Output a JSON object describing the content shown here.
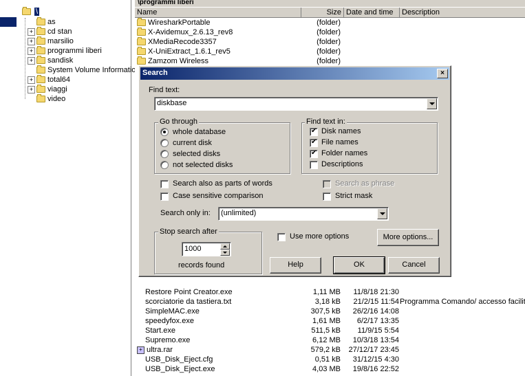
{
  "path_bar": {
    "text": "\\programmi liberi"
  },
  "tree": {
    "root_label": "\\",
    "items": [
      {
        "label": "as",
        "expandable": false
      },
      {
        "label": "cd stan",
        "expandable": true
      },
      {
        "label": "marsilio",
        "expandable": true
      },
      {
        "label": "programmi liberi",
        "expandable": true
      },
      {
        "label": "sandisk",
        "expandable": true
      },
      {
        "label": "System Volume Information",
        "expandable": false
      },
      {
        "label": "total64",
        "expandable": true
      },
      {
        "label": "viaggi",
        "expandable": true
      },
      {
        "label": "video",
        "expandable": false
      }
    ]
  },
  "list": {
    "headers": {
      "name": "Name",
      "size": "Size",
      "date": "Date and time",
      "desc": "Description"
    },
    "top_rows": [
      {
        "name": "WiresharkPortable",
        "size": "(folder)",
        "date": "",
        "desc": ""
      },
      {
        "name": "X-Avidemux_2.6.13_rev8",
        "size": "(folder)",
        "date": "",
        "desc": ""
      },
      {
        "name": "XMediaRecode3357",
        "size": "(folder)",
        "date": "",
        "desc": ""
      },
      {
        "name": "X-UniExtract_1.6.1_rev5",
        "size": "(folder)",
        "date": "",
        "desc": ""
      },
      {
        "name": "Zamzom Wireless",
        "size": "(folder)",
        "date": "",
        "desc": ""
      }
    ],
    "bottom_rows": [
      {
        "name": "Restore Point Creator.exe",
        "size": "1,11 MB",
        "date": "11/8/18 21:30",
        "desc": ""
      },
      {
        "name": "scorciatorie da tastiera.txt",
        "size": "3,18 kB",
        "date": "21/2/15 11:54",
        "desc": "Programma Comando/ accesso facilita"
      },
      {
        "name": "SimpleMAC.exe",
        "size": "307,5 kB",
        "date": "26/2/16 14:08",
        "desc": ""
      },
      {
        "name": "speedyfox.exe",
        "size": "1,61 MB",
        "date": "6/2/17 13:35",
        "desc": ""
      },
      {
        "name": "Start.exe",
        "size": "511,5 kB",
        "date": "11/9/15  5:54",
        "desc": ""
      },
      {
        "name": "Supremo.exe",
        "size": "6,12 MB",
        "date": "10/3/18 13:54",
        "desc": ""
      },
      {
        "name": "ultra.rar",
        "size": "579,2 kB",
        "date": "27/12/17 23:45",
        "desc": ""
      },
      {
        "name": "USB_Disk_Eject.cfg",
        "size": "0,51 kB",
        "date": "31/12/15  4:30",
        "desc": ""
      },
      {
        "name": "USB_Disk_Eject.exe",
        "size": "4,03 MB",
        "date": "19/8/16 22:52",
        "desc": ""
      }
    ]
  },
  "dialog": {
    "title": "Search",
    "close_glyph": "×",
    "find_text_label": "Find text:",
    "find_text_value": "diskbase",
    "go_through": {
      "title": "Go through",
      "options": [
        {
          "label": "whole database",
          "checked": true
        },
        {
          "label": "current disk",
          "checked": false
        },
        {
          "label": "selected disks",
          "checked": false
        },
        {
          "label": "not selected disks",
          "checked": false
        }
      ]
    },
    "find_text_in": {
      "title": "Find text in:",
      "options": [
        {
          "label": "Disk names",
          "checked": true
        },
        {
          "label": "File names",
          "checked": true
        },
        {
          "label": "Folder names",
          "checked": true
        },
        {
          "label": "Descriptions",
          "checked": false
        }
      ]
    },
    "search_parts_of_words": "Search also as parts of words",
    "case_sensitive": "Case sensitive comparison",
    "search_as_phrase": "Search as phrase",
    "strict_mask": "Strict mask",
    "search_only_in_label": "Search only in:",
    "search_only_in_value": "(unlimited)",
    "stop_search": {
      "title": "Stop search after",
      "value": "1000",
      "suffix": "records found"
    },
    "use_more_options": "Use more options",
    "more_options_button": "More options...",
    "help_button": "Help",
    "ok_button": "OK",
    "cancel_button": "Cancel"
  }
}
